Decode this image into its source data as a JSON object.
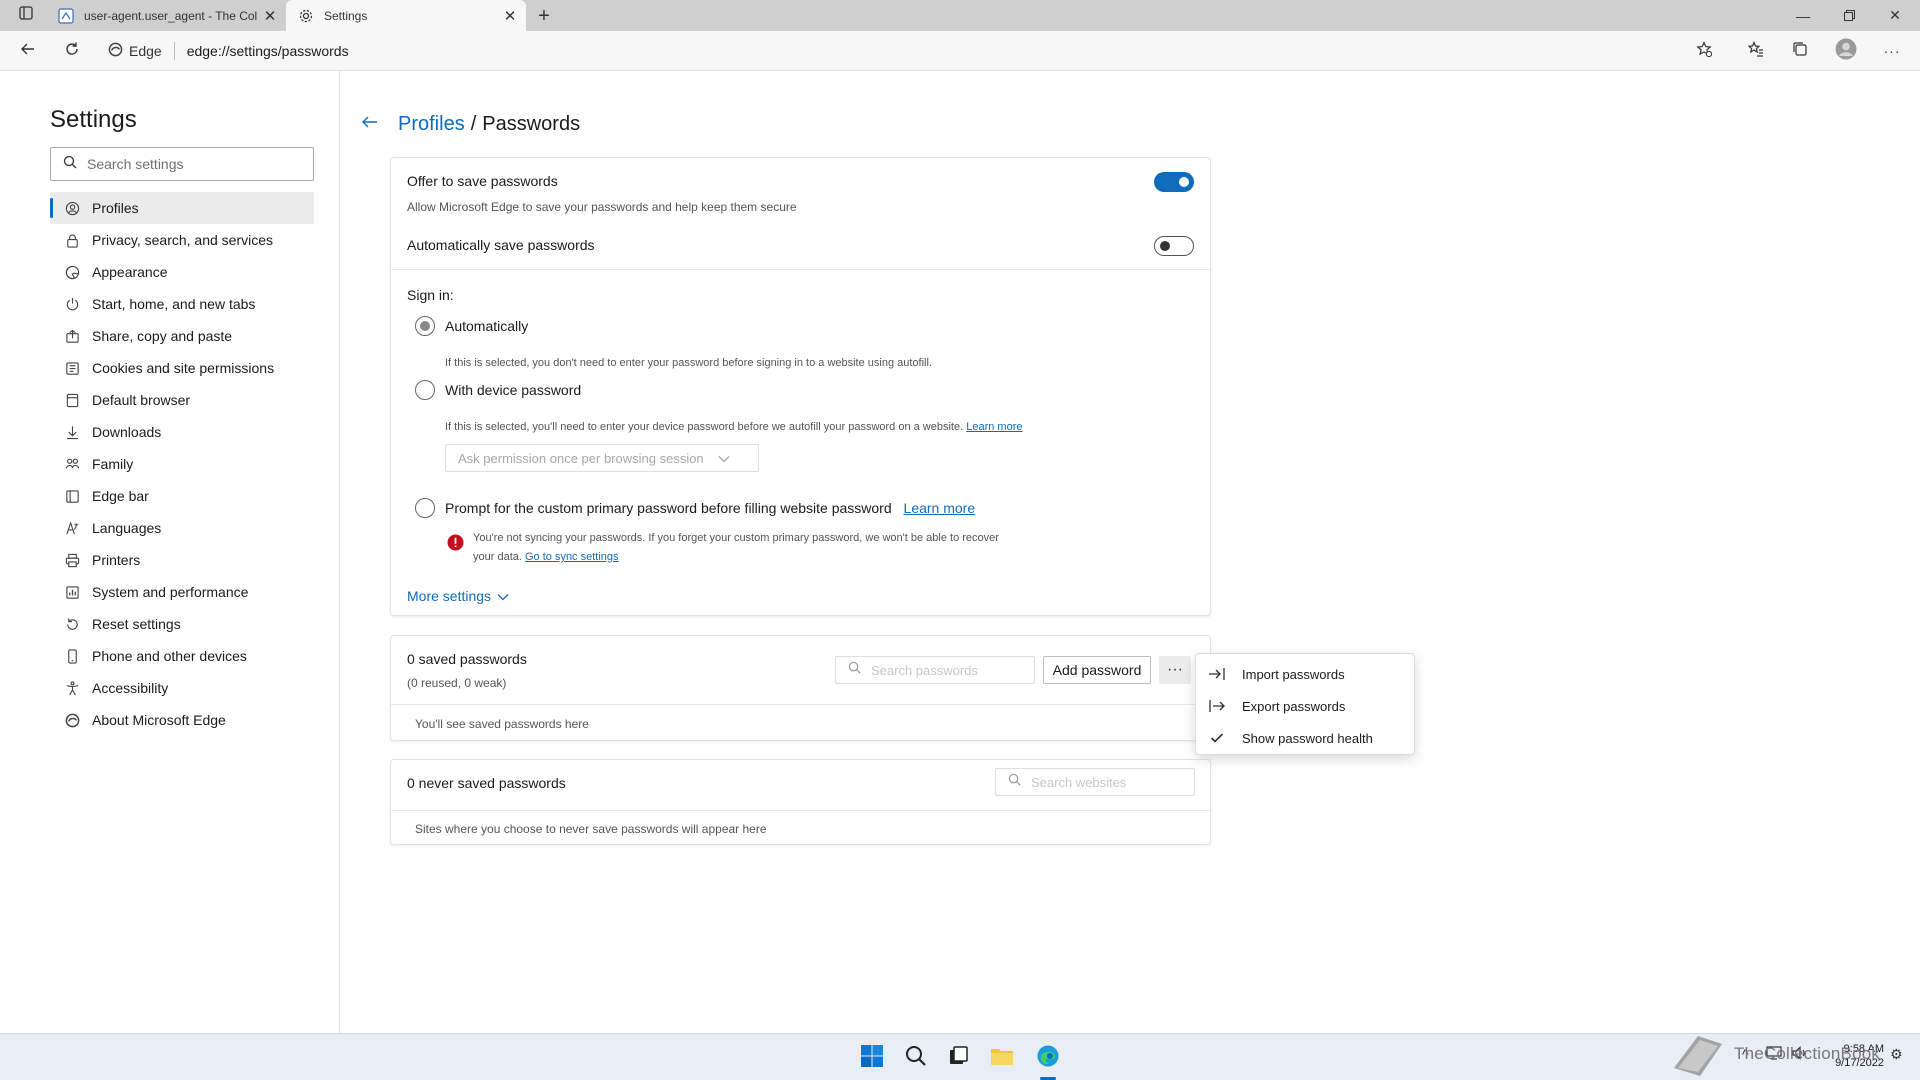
{
  "colors": {
    "accent": "#0f6cbd",
    "error": "#c50f1f"
  },
  "tabs": [
    {
      "title": "user-agent.user_agent - The Coll",
      "icon": "page-icon"
    },
    {
      "title": "Settings",
      "icon": "gear-icon"
    }
  ],
  "address": {
    "site": "Edge",
    "url": "edge://settings/passwords"
  },
  "sidebar": {
    "title": "Settings",
    "search_placeholder": "Search settings",
    "items": [
      {
        "label": "Profiles",
        "icon": "profile-icon",
        "active": true
      },
      {
        "label": "Privacy, search, and services",
        "icon": "lock-icon"
      },
      {
        "label": "Appearance",
        "icon": "appearance-icon"
      },
      {
        "label": "Start, home, and new tabs",
        "icon": "power-icon"
      },
      {
        "label": "Share, copy and paste",
        "icon": "share-icon"
      },
      {
        "label": "Cookies and site permissions",
        "icon": "cookies-icon"
      },
      {
        "label": "Default browser",
        "icon": "browser-icon"
      },
      {
        "label": "Downloads",
        "icon": "download-icon"
      },
      {
        "label": "Family",
        "icon": "family-icon"
      },
      {
        "label": "Edge bar",
        "icon": "edge-bar-icon"
      },
      {
        "label": "Languages",
        "icon": "languages-icon"
      },
      {
        "label": "Printers",
        "icon": "printer-icon"
      },
      {
        "label": "System and performance",
        "icon": "system-icon"
      },
      {
        "label": "Reset settings",
        "icon": "reset-icon"
      },
      {
        "label": "Phone and other devices",
        "icon": "phone-icon"
      },
      {
        "label": "Accessibility",
        "icon": "accessibility-icon"
      },
      {
        "label": "About Microsoft Edge",
        "icon": "edge-icon"
      }
    ]
  },
  "breadcrumb": {
    "parent": "Profiles",
    "separator": "/",
    "current": "Passwords"
  },
  "settings": {
    "offer_title": "Offer to save passwords",
    "offer_desc": "Allow Microsoft Edge to save your passwords and help keep them secure",
    "offer_on": true,
    "auto_title": "Automatically save passwords",
    "auto_on": false,
    "signin_label": "Sign in:",
    "options": [
      {
        "label": "Automatically",
        "desc": "If this is selected, you don't need to enter your password before signing in to a website using autofill.",
        "checked": true
      },
      {
        "label": "With device password",
        "desc": "If this is selected, you'll need to enter your device password before we autofill your password on a website.",
        "link": "Learn more",
        "checked": false
      },
      {
        "label": "Prompt for the custom primary password before filling website password",
        "link": "Learn more",
        "checked": false
      }
    ],
    "permission_select": "Ask permission once per browsing session",
    "warning_text": "You're not syncing your passwords. If you forget your custom primary password, we won't be able to recover your data.",
    "warning_link": "Go to sync settings",
    "more_settings": "More settings"
  },
  "saved": {
    "title": "0 saved passwords",
    "subtitle": "(0 reused, 0 weak)",
    "search_placeholder": "Search passwords",
    "add_button": "Add password",
    "more_button": "···",
    "empty": "You'll see saved passwords here"
  },
  "never_saved": {
    "title": "0 never saved passwords",
    "search_placeholder": "Search websites",
    "empty": "Sites where you choose to never save passwords will appear here"
  },
  "menu": {
    "items": [
      {
        "label": "Import passwords",
        "icon": "import-icon"
      },
      {
        "label": "Export passwords",
        "icon": "export-icon"
      },
      {
        "label": "Show password health",
        "icon": "checkmark-icon"
      }
    ]
  },
  "taskbar": {
    "time": "9:58 AM",
    "date": "9/17/2022",
    "watermark": "TheCollectionBook"
  }
}
